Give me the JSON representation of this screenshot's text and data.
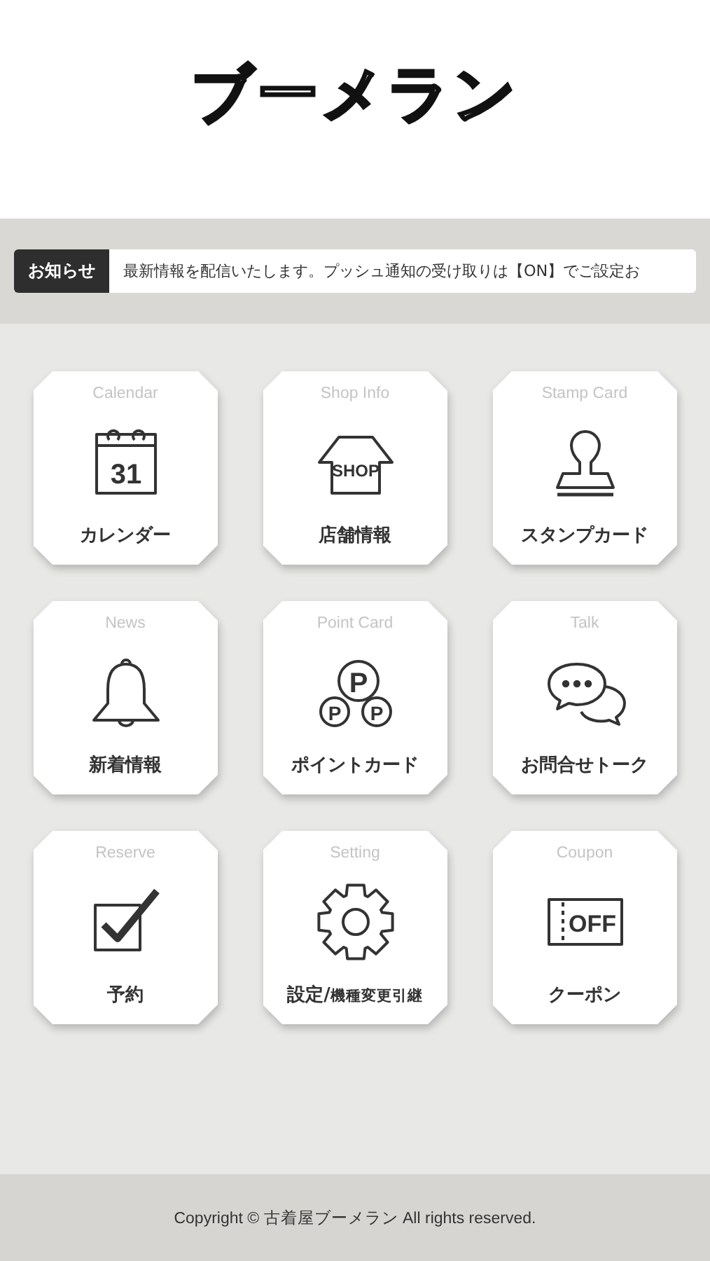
{
  "header": {
    "logo": "ブーメラン"
  },
  "notice": {
    "label": "お知らせ",
    "text": "最新情報を配信いたします。プッシュ通知の受け取りは【ON】でご設定お"
  },
  "menu": [
    {
      "kind": "calendar",
      "caption": "Calendar",
      "label": "カレンダー",
      "icon_texts": [
        "31"
      ]
    },
    {
      "kind": "shop",
      "caption": "Shop Info",
      "label": "店舗情報",
      "icon_texts": [
        "SHOP"
      ]
    },
    {
      "kind": "stamp",
      "caption": "Stamp Card",
      "label": "スタンプカード"
    },
    {
      "kind": "bell",
      "caption": "News",
      "label": "新着情報"
    },
    {
      "kind": "points",
      "caption": "Point Card",
      "label": "ポイントカード",
      "icon_texts": [
        "P",
        "P",
        "P"
      ]
    },
    {
      "kind": "chat",
      "caption": "Talk",
      "label": "お問合せトーク"
    },
    {
      "kind": "check",
      "caption": "Reserve",
      "label": "予約"
    },
    {
      "kind": "gear",
      "caption": "Setting",
      "label": "設定/**機種変更引継**"
    },
    {
      "kind": "coupon",
      "caption": "Coupon",
      "label": "クーポン",
      "icon_texts": [
        "OFF"
      ]
    }
  ],
  "footer": {
    "copyright": "Copyright © 古着屋ブーメラン All rights reserved."
  }
}
